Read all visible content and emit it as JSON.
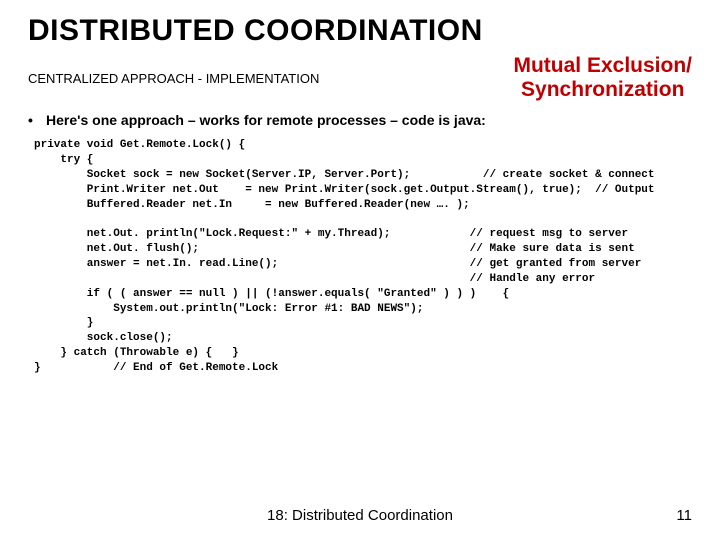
{
  "title": "DISTRIBUTED COORDINATION",
  "subtitle": "CENTRALIZED APPROACH - IMPLEMENTATION",
  "topic_line1": "Mutual Exclusion/",
  "topic_line2": "Synchronization",
  "bullet": "Here's one approach – works for remote processes – code is java:",
  "code": "private void Get.Remote.Lock() {\n    try {\n        Socket sock = new Socket(Server.IP, Server.Port);           // create socket & connect\n        Print.Writer net.Out    = new Print.Writer(sock.get.Output.Stream(), true);  // Output\n        Buffered.Reader net.In     = new Buffered.Reader(new …. );\n\n        net.Out. println(\"Lock.Request:\" + my.Thread);            // request msg to server\n        net.Out. flush();                                         // Make sure data is sent\n        answer = net.In. read.Line();                             // get granted from server\n                                                                  // Handle any error\n        if ( ( answer == null ) || (!answer.equals( \"Granted\" ) ) )    {\n            System.out.println(\"Lock: Error #1: BAD NEWS\");\n        }\n        sock.close();\n    } catch (Throwable e) {   }\n}           // End of Get.Remote.Lock",
  "footer_center": "18: Distributed Coordination",
  "footer_right": "11"
}
